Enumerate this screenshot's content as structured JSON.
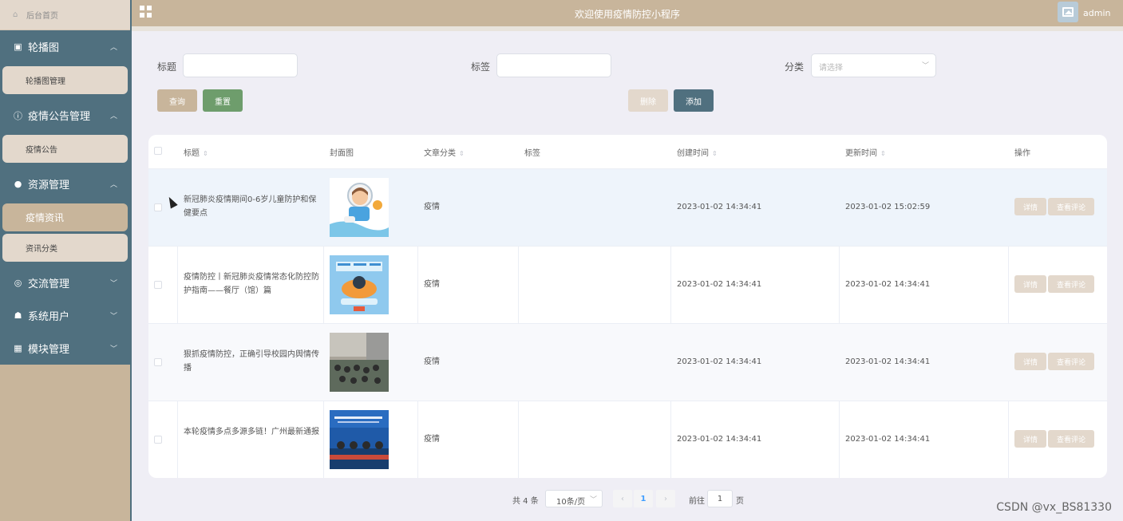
{
  "topbar": {
    "title": "欢迎使用疫情防控小程序",
    "username": "admin"
  },
  "sidebar": {
    "home": "后台首页",
    "groups": [
      {
        "label": "轮播图",
        "icon": "image-icon",
        "expanded": true,
        "items": [
          "轮播图管理"
        ]
      },
      {
        "label": "疫情公告管理",
        "icon": "info-icon",
        "expanded": true,
        "items": [
          "疫情公告"
        ]
      },
      {
        "label": "资源管理",
        "icon": "bulb-icon",
        "expanded": true,
        "items": [
          "疫情资讯",
          "资讯分类"
        ],
        "active": "疫情资讯"
      },
      {
        "label": "交流管理",
        "icon": "chat-icon",
        "expanded": false,
        "items": []
      },
      {
        "label": "系统用户",
        "icon": "user-icon",
        "expanded": false,
        "items": []
      },
      {
        "label": "模块管理",
        "icon": "grid-icon",
        "expanded": false,
        "items": []
      }
    ]
  },
  "search": {
    "title_label": "标题",
    "title_value": "",
    "tag_label": "标签",
    "tag_value": "",
    "category_label": "分类",
    "category_placeholder": "请选择"
  },
  "buttons": {
    "query": "查询",
    "reset": "重置",
    "delete": "删除",
    "add": "添加"
  },
  "table": {
    "columns": [
      "标题",
      "封面图",
      "文章分类",
      "标签",
      "创建时间",
      "更新时间",
      "操作"
    ],
    "rows": [
      {
        "title": "新冠肺炎疫情期间0-6岁儿童防护和保健要点",
        "category": "疫情",
        "tag": "",
        "created": "2023-01-02 14:34:41",
        "updated": "2023-01-02 15:02:59"
      },
      {
        "title": "疫情防控丨新冠肺炎疫情常态化防控防护指南——餐厅（馆）篇",
        "category": "疫情",
        "tag": "",
        "created": "2023-01-02 14:34:41",
        "updated": "2023-01-02 14:34:41"
      },
      {
        "title": "狠抓疫情防控，正确引导校园内舆情传播",
        "category": "疫情",
        "tag": "",
        "created": "2023-01-02 14:34:41",
        "updated": "2023-01-02 14:34:41"
      },
      {
        "title": "本轮疫情多点多源多链！广州最新通报",
        "category": "疫情",
        "tag": "",
        "created": "2023-01-02 14:34:41",
        "updated": "2023-01-02 14:34:41"
      }
    ],
    "row_actions": {
      "detail": "详情",
      "comments": "查看评论"
    }
  },
  "pager": {
    "total": "共 4 条",
    "page_size": "10条/页",
    "current_page": "1",
    "goto_label": "前往",
    "goto_value": "1",
    "page_suffix": "页",
    "prev": "‹",
    "next": "›"
  },
  "watermark": "CSDN @vx_BS81330",
  "colors": {
    "sidebar_bg": "#c8b59b",
    "menu_bg": "#50707f",
    "reset_btn": "#6e9d6c",
    "add_btn": "#50707f"
  }
}
